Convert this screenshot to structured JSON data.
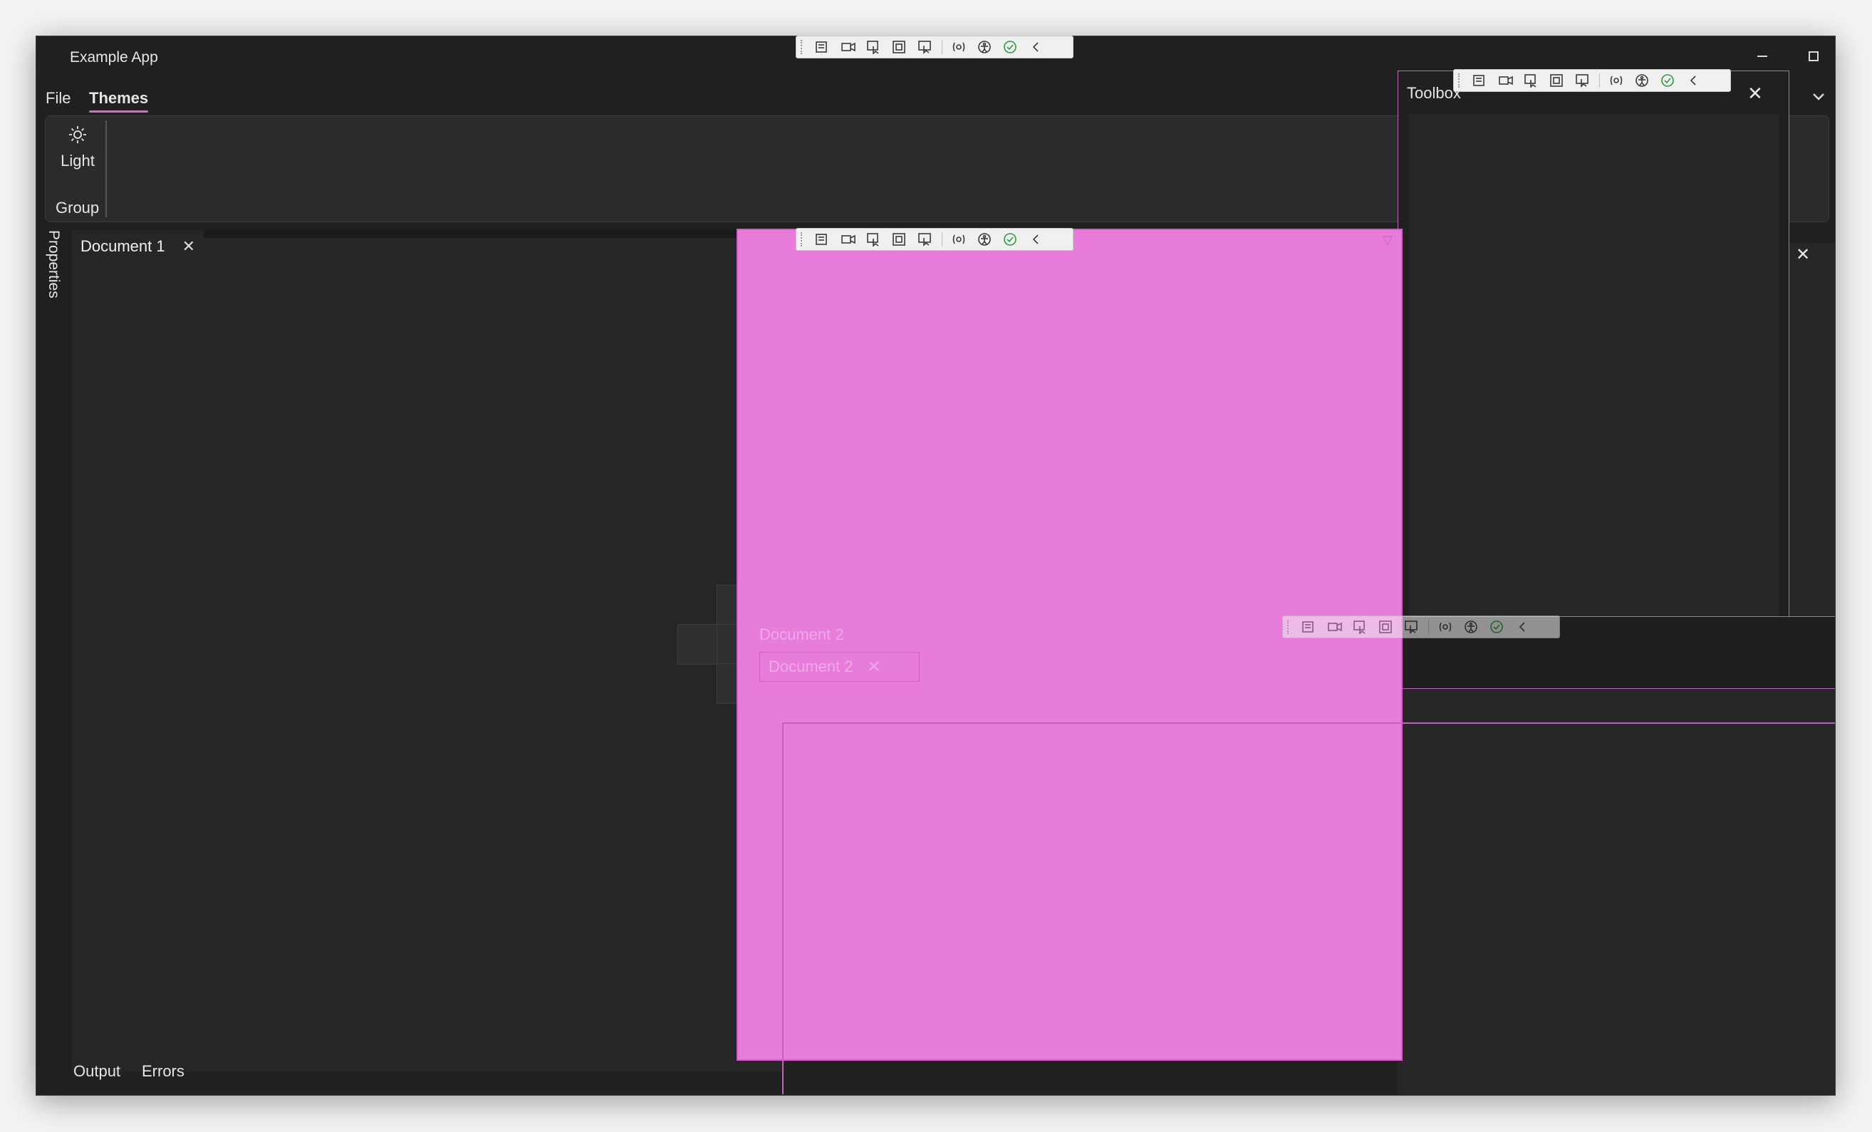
{
  "window": {
    "title": "Example App"
  },
  "menu": {
    "items": [
      "File",
      "Themes"
    ],
    "active": "Themes"
  },
  "ribbon": {
    "button_label": "Light",
    "group_label": "Group"
  },
  "properties": {
    "label": "Properties"
  },
  "documents": {
    "tab1": {
      "label": "Document 1",
      "close": "✕"
    },
    "dragging_label": "Document 2",
    "dragging_tab": {
      "label": "Document 2",
      "close": "✕"
    }
  },
  "bottom_tabs": {
    "output": "Output",
    "errors": "Errors"
  },
  "toolbox": {
    "title": "Toolbox",
    "close": "✕"
  },
  "right_pane": {
    "close": "✕"
  },
  "colors": {
    "accent": "#d66ad0",
    "dock_overlay": "#e87cdb",
    "background": "#202020"
  },
  "icons": {
    "dev_toolbar": [
      "live-tree-icon",
      "record-icon",
      "select-element-icon",
      "display-layout-adorners-icon",
      "track-focus-icon",
      "binding-failures-icon",
      "accessibility-icon",
      "check-icon",
      "collapse-icon"
    ]
  }
}
